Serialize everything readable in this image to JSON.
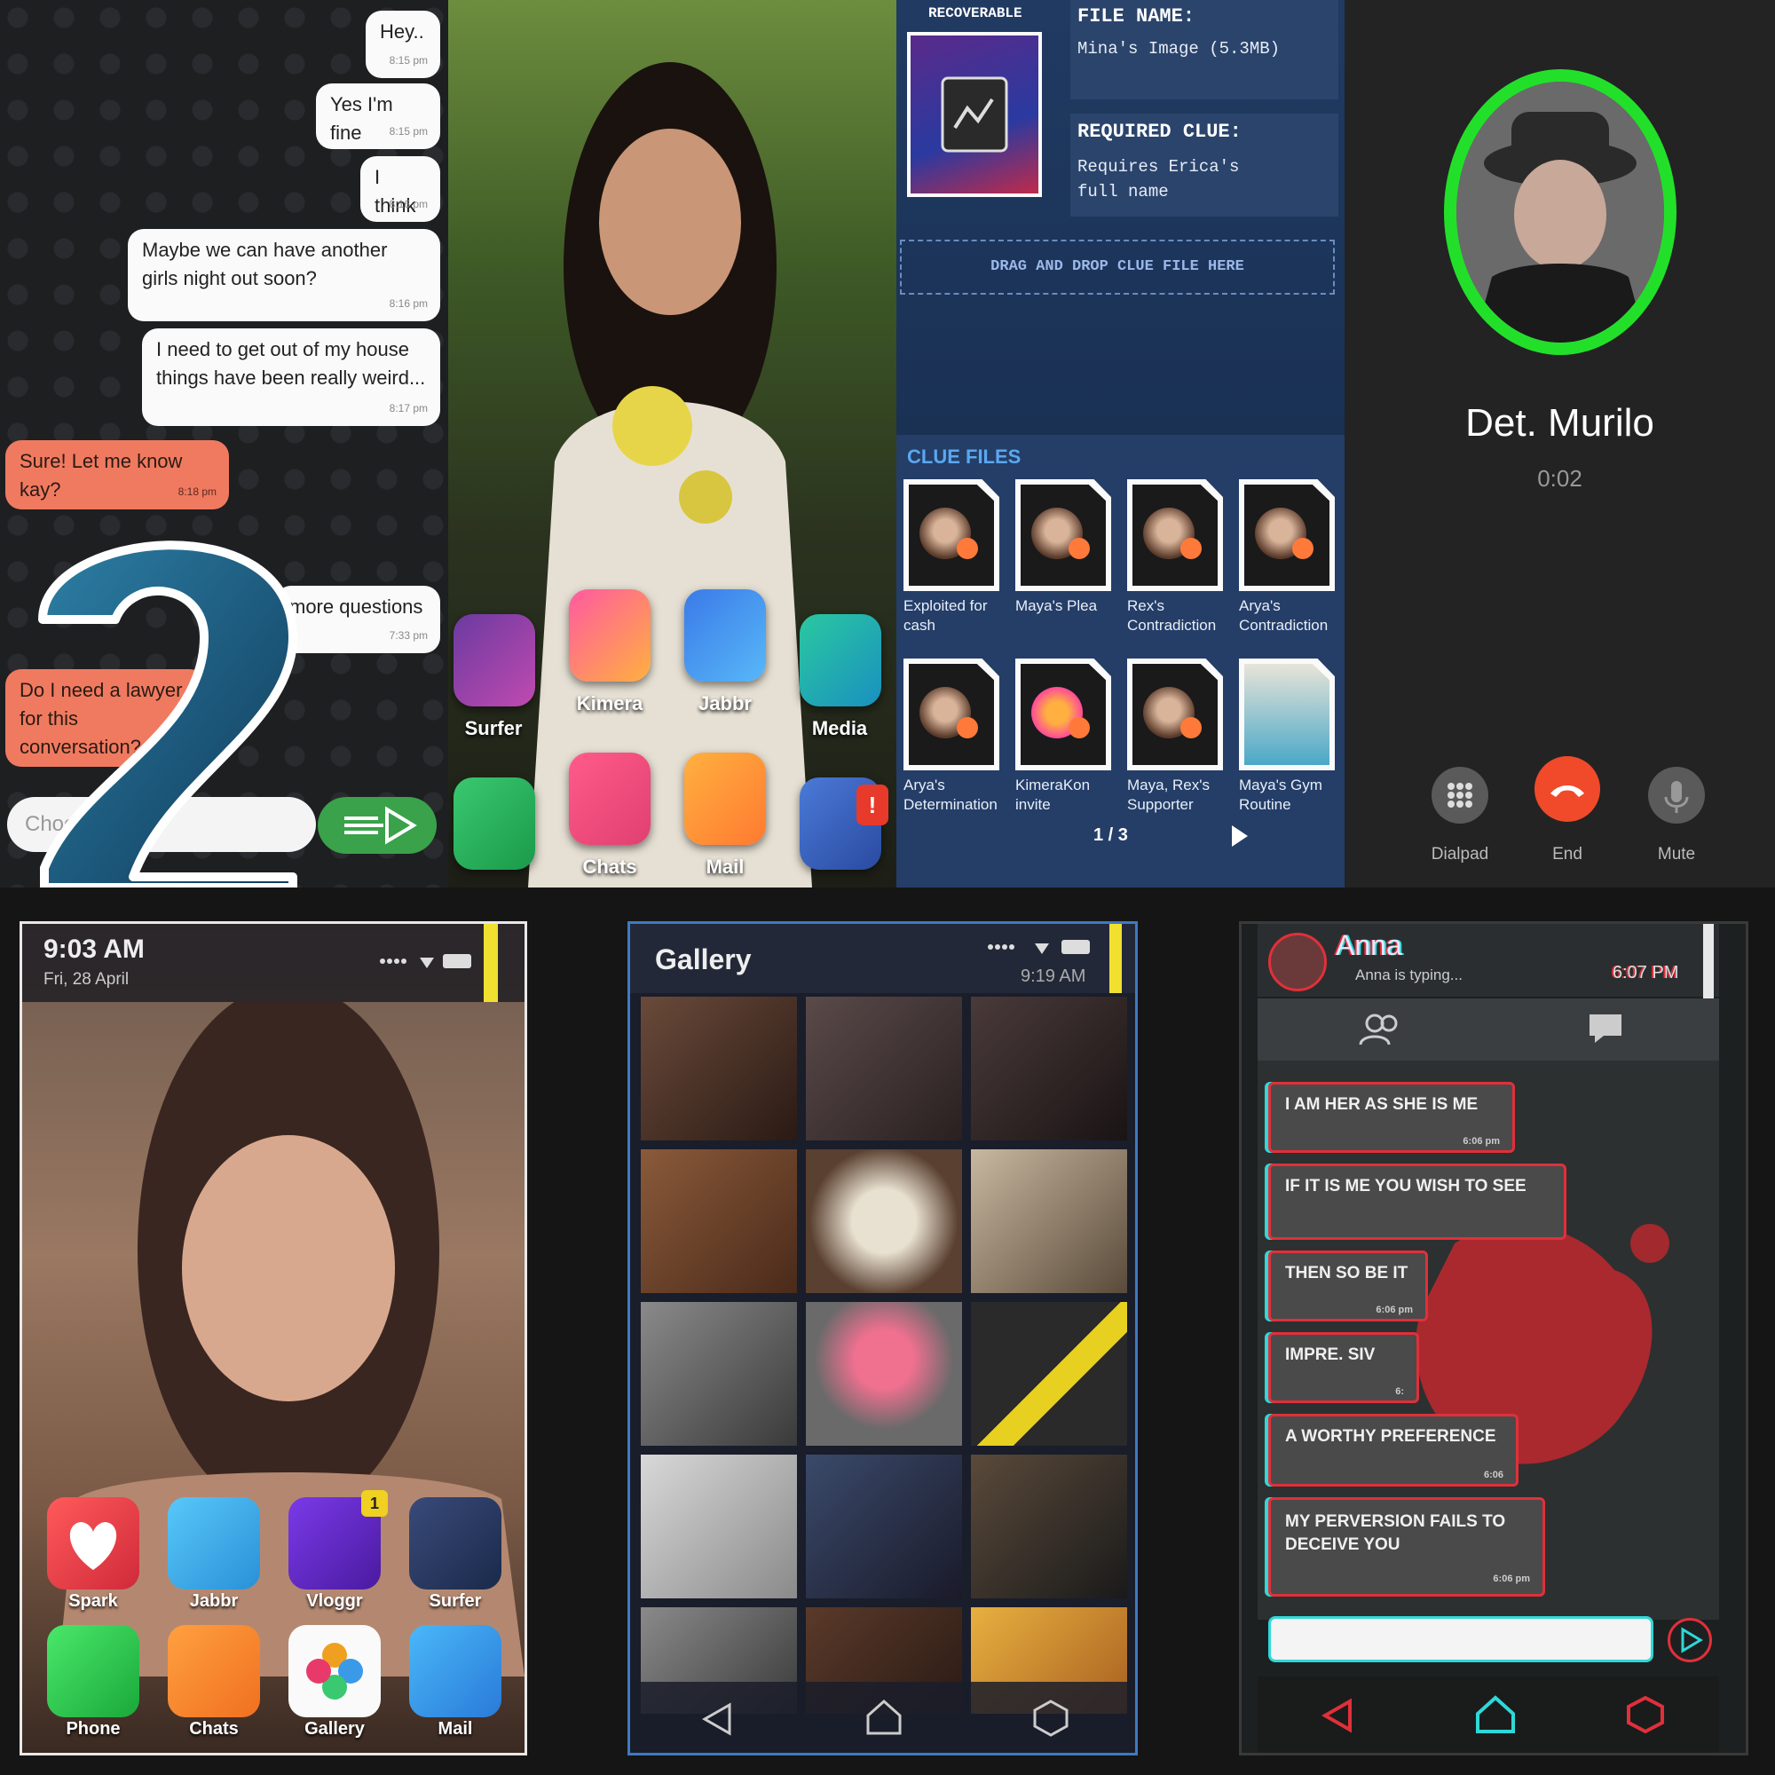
{
  "chat": {
    "messages": [
      {
        "text": "Hey..",
        "time": "8:15 pm"
      },
      {
        "text": "Yes I'm fine",
        "time": "8:15 pm"
      },
      {
        "text": "I think",
        "time": "8:16 pm"
      },
      {
        "text": "Maybe we can have another girls night out soon?",
        "time": "8:16 pm"
      },
      {
        "text": "I need to get out of my house things have been really weird...",
        "time": "8:17 pm"
      },
      {
        "text": "Sure! Let me know kay?",
        "time": "8:18 pm"
      },
      {
        "text": "more questions",
        "time": "7:33 pm"
      },
      {
        "text": "Do I need a lawyer for this conversation?",
        "time": ""
      }
    ],
    "input_placeholder": "Choo",
    "big_number": "2"
  },
  "home": {
    "apps_row1": [
      "Surfer",
      "Kimera",
      "Jabbr",
      "Media"
    ],
    "apps_row2": [
      "Chats",
      "Mail"
    ],
    "notification_badge": "!"
  },
  "clue": {
    "recoverable_label": "RECOVERABLE",
    "file_name_label": "FILE NAME:",
    "file_name_value": "Mina's Image (5.3MB)",
    "required_clue_label": "REQUIRED CLUE:",
    "required_clue_value": "Requires Erica's full name",
    "drop_hint": "DRAG AND DROP CLUE FILE HERE",
    "clue_files_title": "CLUE FILES",
    "files": [
      "Exploited for cash",
      "Maya's Plea",
      "Rex's Contradiction",
      "Arya's Contradiction",
      "Arya's Determination",
      "KimeraKon invite",
      "Maya, Rex's Supporter",
      "Maya's Gym Routine"
    ],
    "pager": "1 / 3"
  },
  "call": {
    "name": "Det. Murilo",
    "duration": "0:02",
    "buttons": [
      "Dialpad",
      "End",
      "Mute"
    ]
  },
  "lock": {
    "time": "9:03 AM",
    "date": "Fri, 28 April",
    "apps_row1": [
      "Spark",
      "Jabbr",
      "Vloggr",
      "Surfer"
    ],
    "apps_row2": [
      "Phone",
      "Chats",
      "Gallery",
      "Mail"
    ],
    "vloggr_badge": "1"
  },
  "gallery": {
    "title": "Gallery",
    "time": "9:19 AM"
  },
  "anna": {
    "name": "Anna",
    "status": "Anna is typing...",
    "time": "6:07 PM",
    "messages": [
      {
        "text": "I AM HER AS SHE IS ME",
        "time": "6:06 pm"
      },
      {
        "text": "IF IT IS ME YOU WISH TO SEE",
        "time": ""
      },
      {
        "text": "THEN SO BE IT",
        "time": "6:06 pm"
      },
      {
        "text": "IMPRE. SIV",
        "time": "6:"
      },
      {
        "text": "A WORTHY PREFERENCE",
        "time": "6:06"
      },
      {
        "text": "MY PERVERSION FAILS TO DECEIVE YOU",
        "time": "6:06 pm"
      }
    ]
  },
  "colors": {
    "chat_out": "#fafafa",
    "chat_in": "#f07a5f",
    "send_green": "#3aa24a",
    "call_ring": "#22e02a",
    "end_red": "#f04a2a",
    "clue_bg": "#162a4a",
    "anna_red": "#e0303a",
    "anna_cyan": "#2fd8d8"
  }
}
